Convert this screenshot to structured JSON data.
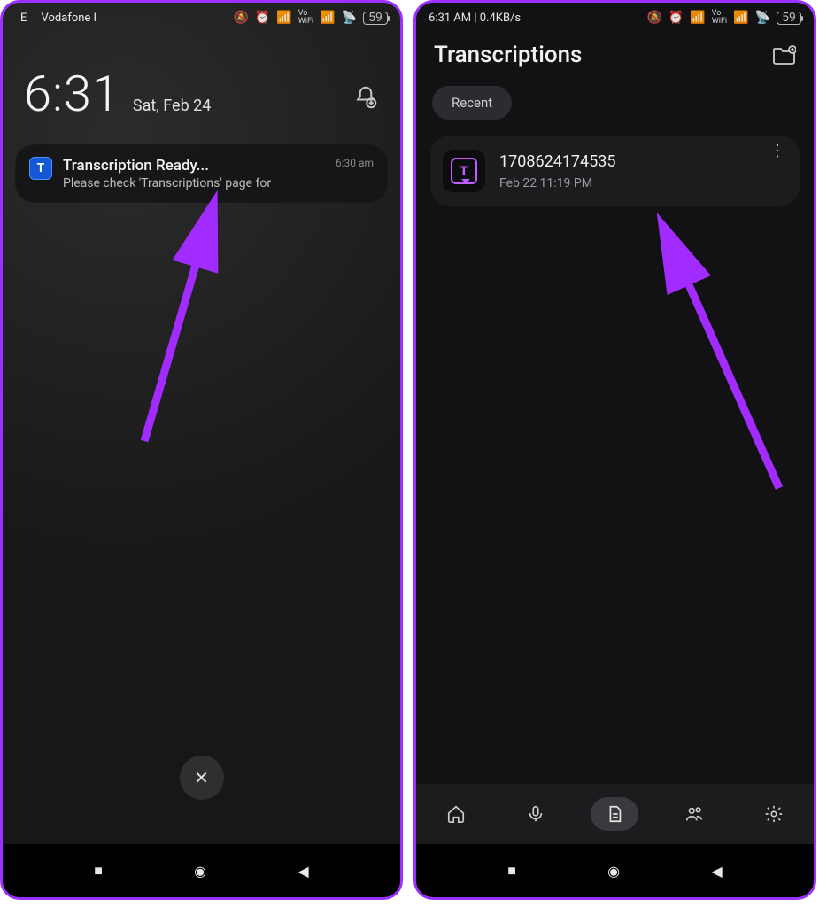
{
  "left": {
    "status": {
      "carrier": "Vodafone I",
      "prefix": "E",
      "battery": "59"
    },
    "clock": {
      "time": "6:31",
      "date": "Sat, Feb 24"
    },
    "notification": {
      "app_letter": "T",
      "title": "Transcription Ready...",
      "body": "Please check 'Transcriptions' page for",
      "time": "6:30 am"
    },
    "close_label": "✕"
  },
  "right": {
    "status": {
      "left_text": "6:31 AM | 0.4KB/s",
      "battery": "59"
    },
    "header": {
      "title": "Transcriptions"
    },
    "filter": {
      "recent": "Recent"
    },
    "item": {
      "thumb_letter": "T",
      "name": "1708624174535",
      "when": "Feb 22 11:19 PM"
    }
  },
  "nav": {
    "recents": "■",
    "home": "◉",
    "back": "◀"
  }
}
